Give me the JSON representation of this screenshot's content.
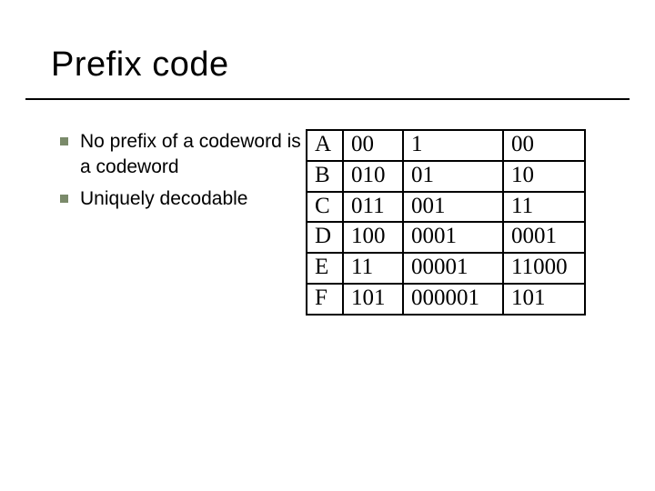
{
  "title": "Prefix code",
  "bullets": [
    "No prefix of a codeword is a codeword",
    "Uniquely decodable"
  ],
  "table": {
    "rows": [
      {
        "sym": "A",
        "c1": "00",
        "c2": "1",
        "c3": "00"
      },
      {
        "sym": "B",
        "c1": "010",
        "c2": "01",
        "c3": "10"
      },
      {
        "sym": "C",
        "c1": "011",
        "c2": "001",
        "c3": "11"
      },
      {
        "sym": "D",
        "c1": "100",
        "c2": "0001",
        "c3": "0001"
      },
      {
        "sym": "E",
        "c1": "11",
        "c2": "00001",
        "c3": "11000"
      },
      {
        "sym": "F",
        "c1": "101",
        "c2": "000001",
        "c3": "101"
      }
    ]
  }
}
